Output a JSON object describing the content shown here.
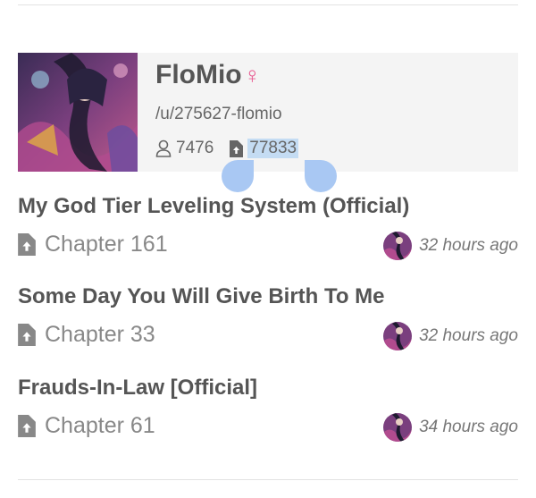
{
  "profile": {
    "name": "FloMio",
    "gender_symbol": "♀",
    "handle": "/u/275627-flomio",
    "followers": "7476",
    "uploads": "77833"
  },
  "feed": [
    {
      "title": "My God Tier Leveling System (Official)",
      "chapter": "Chapter 161",
      "time": "32 hours ago"
    },
    {
      "title": "Some Day You Will Give Birth To Me",
      "chapter": "Chapter 33",
      "time": "32 hours ago"
    },
    {
      "title": "Frauds-In-Law [Official]",
      "chapter": "Chapter 61",
      "time": "34 hours ago"
    }
  ],
  "colors": {
    "accent_pink": "#e8588f",
    "selection": "#c4dcf3",
    "selection_handle": "#a9c8f3"
  },
  "icons": {
    "followers": "user-icon",
    "uploads": "file-upload-icon",
    "chapter": "file-upload-icon"
  }
}
